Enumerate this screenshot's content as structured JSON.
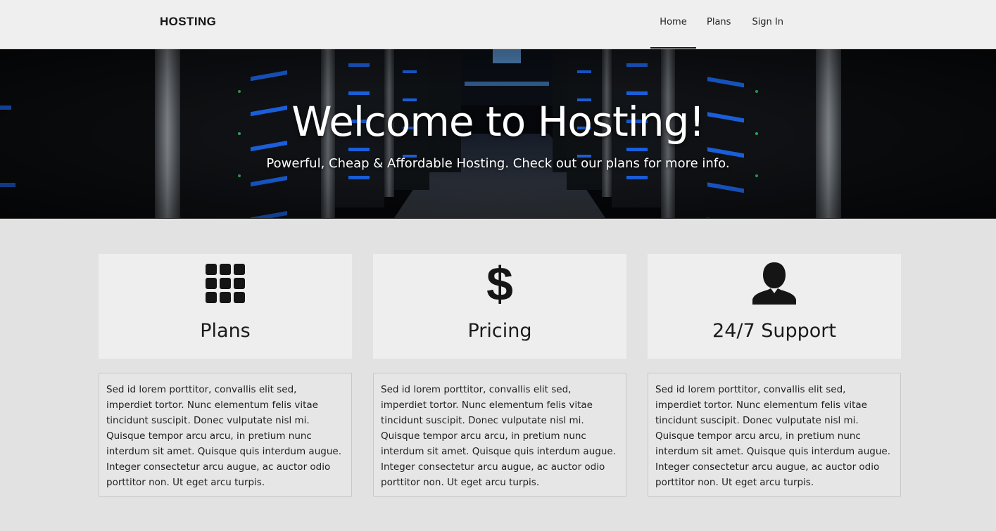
{
  "navbar": {
    "brand": "HOSTING",
    "links": [
      "Home",
      "Plans",
      "Sign In"
    ],
    "active_index": 0
  },
  "hero": {
    "title": "Welcome to Hosting!",
    "subtitle": "Powerful, Cheap & Affordable Hosting. Check out our plans for more info."
  },
  "features": [
    {
      "icon": "grid-icon",
      "title": "Plans",
      "text": "Sed id lorem porttitor, convallis elit sed, imperdiet tortor. Nunc elementum felis vitae tincidunt suscipit. Donec vulputate nisl mi. Quisque tempor arcu arcu, in pretium nunc interdum sit amet. Quisque quis interdum augue. Integer consectetur arcu augue, ac auctor odio porttitor non. Ut eget arcu turpis."
    },
    {
      "icon": "dollar-icon",
      "title": "Pricing",
      "text": "Sed id lorem porttitor, convallis elit sed, imperdiet tortor. Nunc elementum felis vitae tincidunt suscipit. Donec vulputate nisl mi. Quisque tempor arcu arcu, in pretium nunc interdum sit amet. Quisque quis interdum augue. Integer consectetur arcu augue, ac auctor odio porttitor non. Ut eget arcu turpis."
    },
    {
      "icon": "user-icon",
      "title": "24/7 Support",
      "text": "Sed id lorem porttitor, convallis elit sed, imperdiet tortor. Nunc elementum felis vitae tincidunt suscipit. Donec vulputate nisl mi. Quisque tempor arcu arcu, in pretium nunc interdum sit amet. Quisque quis interdum augue. Integer consectetur arcu augue, ac auctor odio porttitor non. Ut eget arcu turpis."
    }
  ],
  "colors": {
    "navbar_bg": "#efefef",
    "page_bg": "#e2e2e2",
    "card_bg": "#eeeeee",
    "server_light": "#1f6fff"
  }
}
